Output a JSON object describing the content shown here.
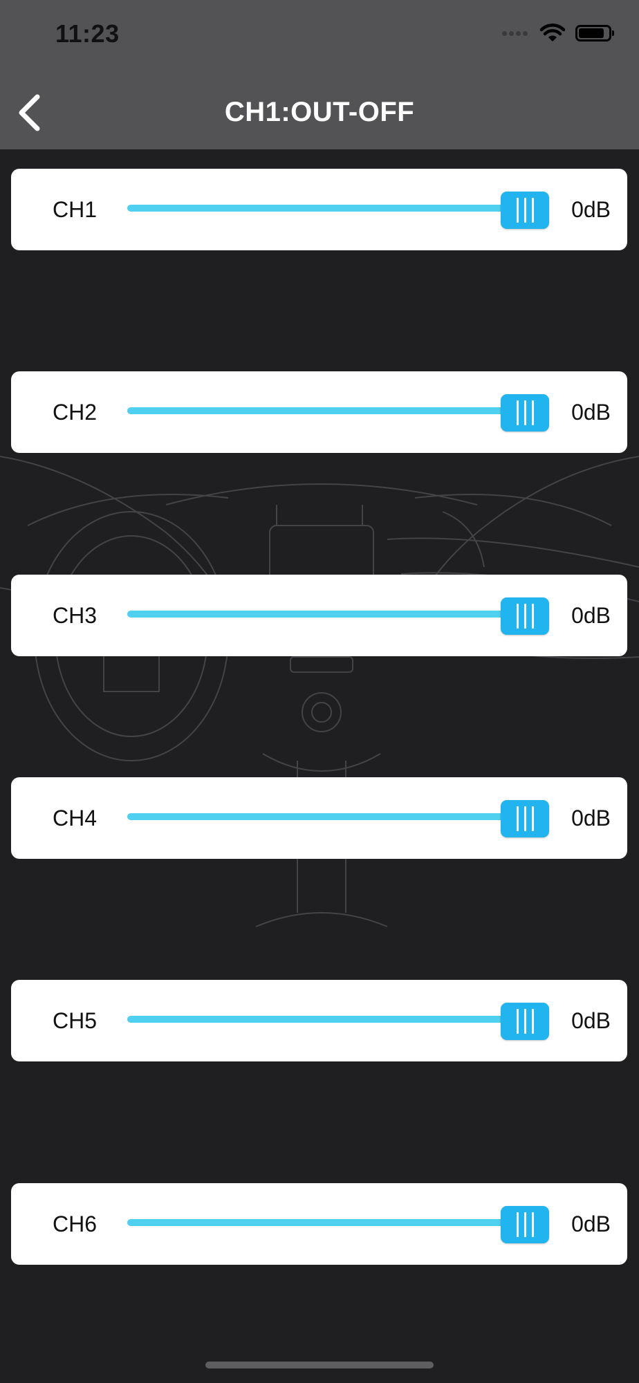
{
  "status_bar": {
    "time": "11:23",
    "battery_level": 0.9
  },
  "header": {
    "title": "CH1:OUT-OFF",
    "back_icon": "chevron-left-icon"
  },
  "channels": [
    {
      "label": "CH1",
      "value": "0dB",
      "level": 1.0
    },
    {
      "label": "CH2",
      "value": "0dB",
      "level": 1.0
    },
    {
      "label": "CH3",
      "value": "0dB",
      "level": 1.0
    },
    {
      "label": "CH4",
      "value": "0dB",
      "level": 1.0
    },
    {
      "label": "CH5",
      "value": "0dB",
      "level": 1.0
    },
    {
      "label": "CH6",
      "value": "0dB",
      "level": 1.0
    }
  ],
  "colors": {
    "slider_fill": "#4fd0f0",
    "slider_thumb": "#21b4ef",
    "header_bg": "#535355",
    "page_bg": "#1f1f22"
  }
}
